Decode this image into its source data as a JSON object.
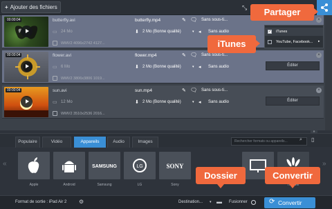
{
  "toolbar": {
    "add_label": "Ajouter des fichiers"
  },
  "files": [
    {
      "duration": "00:00:04",
      "name": "butterfly.avi",
      "size": "24 Mo",
      "meta": "WMV2 4096x2742 4127...",
      "out_name": "butterfly.mp4",
      "out_size": "2 Mo (Bonne qualité)",
      "subtitles": "Sans sous-ti...",
      "audio": "Sans audio",
      "selected": true
    },
    {
      "duration": "00:00:04",
      "name": "flower.avi",
      "size": "6 Mo",
      "meta": "WMV2 3806x3806 1019...",
      "out_name": "flower.mp4",
      "out_size": "2 Mo (Bonne qualité)",
      "subtitles": "Sans sous-ti...",
      "audio": "Sans audio",
      "edit_label": "Éditer",
      "selected": true
    },
    {
      "duration": "00:00:04",
      "name": "sun.avi",
      "size": "12 Mo",
      "meta": "WMV2 3510x2536 2016...",
      "out_name": "sun.mp4",
      "out_size": "2 Mo (Bonne qualité)",
      "subtitles": "Sans sous-ti...",
      "audio": "Sans audio",
      "edit_label": "Éditer",
      "selected": false
    }
  ],
  "share_menu": {
    "items": [
      "iTunes",
      "YouTube, Facebook..."
    ]
  },
  "format_tabs": [
    "Populaire",
    "Vidéo",
    "Appareils",
    "Audio",
    "Images"
  ],
  "active_tab": "Appareils",
  "search": {
    "placeholder": "Rechercher formats ou appareils..."
  },
  "devices": [
    "Apple",
    "Android",
    "Samsung",
    "LG",
    "Sony",
    "",
    "Huawei"
  ],
  "bottom": {
    "format_label": "Format de sortie : iPad Air 2",
    "destination": "Destination...",
    "merge": "Fusionner",
    "convert": "Convertir"
  },
  "callouts": {
    "share": "Partager",
    "itunes": "iTunes",
    "folder": "Dossier",
    "convert": "Convertir"
  },
  "colors": {
    "accent": "#3a8fd6",
    "callout": "#f0693d",
    "selected_row": "#6b7389"
  }
}
